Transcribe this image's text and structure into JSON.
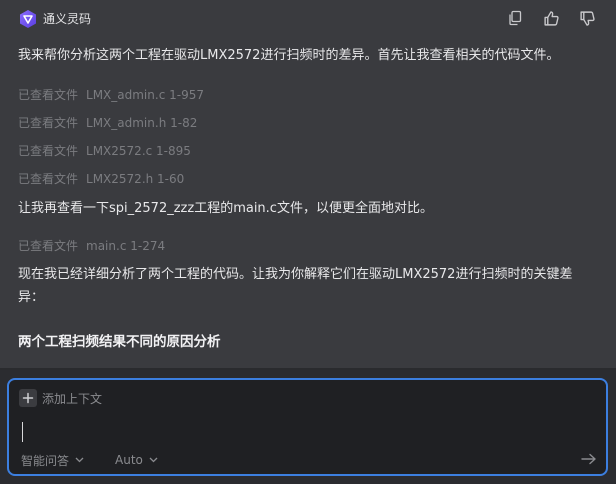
{
  "assistant": {
    "name": "通义灵码",
    "icons": [
      "copy-icon",
      "thumbs-up-icon",
      "thumbs-down-icon"
    ]
  },
  "messages": {
    "intro": "我来帮你分析这两个工程在驱动LMX2572进行扫频时的差异。首先让我查看相关的代码文件。",
    "refs_first": [
      {
        "label": "已查看文件",
        "file": "LMX_admin.c 1-957"
      },
      {
        "label": "已查看文件",
        "file": "LMX_admin.h 1-82"
      },
      {
        "label": "已查看文件",
        "file": "LMX2572.c 1-895"
      },
      {
        "label": "已查看文件",
        "file": "LMX2572.h 1-60"
      }
    ],
    "second": "让我再查看一下spi_2572_zzz工程的main.c文件，以便更全面地对比。",
    "refs_second": [
      {
        "label": "已查看文件",
        "file": "main.c 1-274"
      }
    ],
    "analysis_line1": "现在我已经详细分析了两个工程的代码。让我为你解释它们在驱动LMX2572进行扫频时的关键差",
    "analysis_line2": "异：",
    "heading": "两个工程扫频结果不同的原因分析"
  },
  "composer": {
    "add_context": "添加上下文",
    "mode": "智能问答",
    "model": "Auto",
    "accent": "#3c7fe0"
  }
}
